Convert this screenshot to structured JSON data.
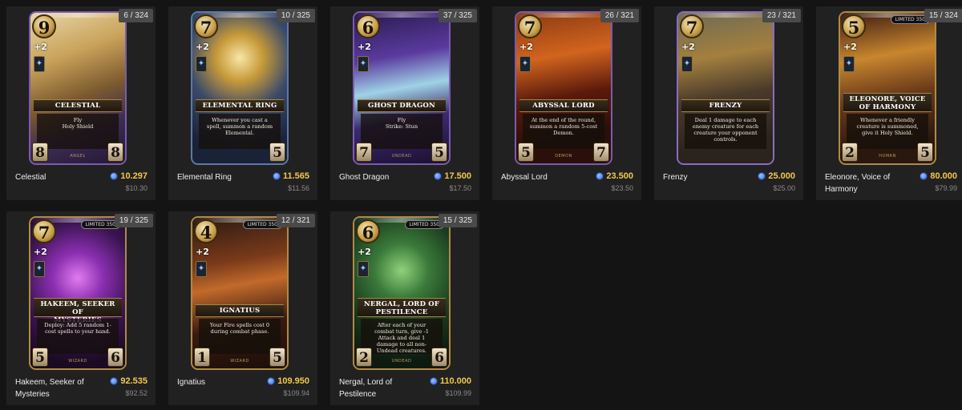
{
  "cards": [
    {
      "name": "Celestial",
      "count": "6 / 324",
      "title_line1": "CELESTIAL",
      "title_line2": "",
      "cost": "9",
      "plus": "+2",
      "text": "Fly\nHoly Shield",
      "type": "ANGEL",
      "attack": "8",
      "health": "8",
      "limited": "",
      "price": "10.297",
      "usd": "$10.30",
      "frame": "#7b5bb0",
      "bg": "linear-gradient(160deg,#e8d7a8 0%,#c8a25a 30%,#7b5a2e 55%,#3e2c54 75%,#221833 100%)"
    },
    {
      "name": "Elemental Ring",
      "count": "10 / 325",
      "title_line1": "ELEMENTAL RING",
      "title_line2": "",
      "cost": "7",
      "plus": "+2",
      "text": "Whenever you cast a spell, summon a random Elemental.",
      "type": "",
      "attack": "",
      "health": "5",
      "limited": "",
      "price": "11.565",
      "usd": "$11.56",
      "frame": "#5b79a8",
      "bg": "radial-gradient(circle at 50% 30%,#f7e6a5 0%,#c79a3a 20%,#3a4a6a 45%,#1a2238 80%)"
    },
    {
      "name": "Ghost Dragon",
      "count": "37 / 325",
      "title_line1": "GHOST DRAGON",
      "title_line2": "",
      "cost": "6",
      "plus": "+2",
      "text": "Fly\nStrike: Stun",
      "type": "UNDEAD",
      "attack": "7",
      "health": "5",
      "limited": "",
      "price": "17.500",
      "usd": "$17.50",
      "frame": "#7b5bb0",
      "bg": "linear-gradient(170deg,#2a1a4e 0%,#5a3a9e 30%,#9fd2e6 50%,#3a2a6e 70%,#1a1030 100%)"
    },
    {
      "name": "Abyssal Lord",
      "count": "26 / 321",
      "title_line1": "ABYSSAL LORD",
      "title_line2": "",
      "cost": "7",
      "plus": "+2",
      "text": "At the end of the round, summon a random 5-cost Demon.",
      "type": "DEMON",
      "attack": "5",
      "health": "7",
      "limited": "",
      "price": "23.500",
      "usd": "$23.50",
      "frame": "#7b5bb0",
      "bg": "linear-gradient(170deg,#8a3a12 0%,#d2641e 30%,#5a1a0a 55%,#2a0f0a 80%)"
    },
    {
      "name": "Frenzy",
      "count": "23 / 321",
      "title_line1": "FRENZY",
      "title_line2": "",
      "cost": "7",
      "plus": "+2",
      "text": "Deal 1 damage to each enemy creature for each creature your opponent controls.",
      "type": "",
      "attack": "",
      "health": "",
      "limited": "",
      "price": "25.000",
      "usd": "$25.00",
      "frame": "#8a6cc4",
      "bg": "linear-gradient(170deg,#6e6a55 0%,#a3803e 30%,#4a3a2a 55%,#2a241c 85%)"
    },
    {
      "name": "Eleonore, Voice of Harmony",
      "count": "15 / 324",
      "title_line1": "ELEONORE, VOICE",
      "title_line2": "OF HARMONY",
      "cost": "5",
      "plus": "+2",
      "text": "Whenever a friendly creature is summoned, give it Holy Shield.",
      "type": "HUMAN",
      "attack": "2",
      "health": "5",
      "limited": "LIMITED 350",
      "price": "80.000",
      "usd": "$79.99",
      "frame": "#b08a45",
      "bg": "linear-gradient(170deg,#3a1a12 0%,#c8862e 30%,#6a3a1a 55%,#2a180e 85%)"
    },
    {
      "name": "Hakeem, Seeker of Mysteries",
      "count": "19 / 325",
      "title_line1": "HAKEEM, SEEKER OF",
      "title_line2": "MYSTERIES",
      "cost": "7",
      "plus": "+2",
      "text": "Deploy: Add 5 random 1-cost spells to your hand.",
      "type": "WIZARD",
      "attack": "5",
      "health": "6",
      "limited": "LIMITED 350",
      "price": "92.535",
      "usd": "$92.52",
      "frame": "#b08a45",
      "bg": "radial-gradient(circle at 50% 40%,#e07bf0 0%,#8a2fb0 25%,#3a1450 55%,#1a0a22 85%)"
    },
    {
      "name": "Ignatius",
      "count": "12 / 321",
      "title_line1": "IGNATIUS",
      "title_line2": "",
      "cost": "4",
      "plus": "+2",
      "text": "Your Fire spells cost 0 during combat phase.",
      "type": "WIZARD",
      "attack": "1",
      "health": "5",
      "limited": "LIMITED 350",
      "price": "109.950",
      "usd": "$109.94",
      "frame": "#b08a45",
      "bg": "linear-gradient(170deg,#2a1a12 0%,#7a3a1a 30%,#c26a2a 45%,#3a1a10 70%,#1a0e08 100%)"
    },
    {
      "name": "Nergal, Lord of Pestilence",
      "count": "15 / 325",
      "title_line1": "NERGAL, LORD OF",
      "title_line2": "PESTILENCE",
      "cost": "6",
      "plus": "+2",
      "text": "After each of your combat turn, give -1 Attack and deal 1 damage to all non-Undead creatures.",
      "type": "UNDEAD",
      "attack": "2",
      "health": "6",
      "limited": "LIMITED 350",
      "price": "110.000",
      "usd": "$109.99",
      "frame": "#b08a45",
      "bg": "radial-gradient(circle at 50% 35%,#8fd27a 0%,#3a7a3a 25%,#1a3a1e 55%,#0e1a10 85%)"
    }
  ]
}
